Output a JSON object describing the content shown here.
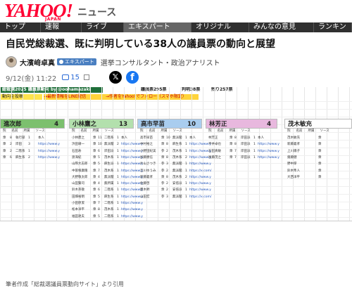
{
  "header": {
    "logo_main": "YAHOO!",
    "logo_sub": "JAPAN",
    "logo_section": "ニュース",
    "nav": [
      "トップ",
      "速報",
      "ライブ",
      "エキスパート",
      "オリジナル",
      "みんなの意見",
      "ランキン"
    ]
  },
  "article": {
    "title": "自民党総裁選、既に判明している38人の議員票の動向と展望",
    "author_name": "大濱﨑卓真",
    "author_badge": "エキスパート",
    "author_title": "選挙コンサルタント・政治アナリスト",
    "date": "9/12(金) 11:22",
    "comment_count": "15",
    "caption": "筆者作成「総裁選議員票動向サイト」より引用"
  },
  "sheet": {
    "site_title": "総裁選2025 議員票動向 by @oohamazaki",
    "row2_left": "動向を投稿",
    "row2_mid": "→最新情報をLINE配信",
    "row2_right": "→作者をYahoo!でフォロー（スマホ限定）",
    "stats_a": "議員票295票",
    "stats_b": "判明38票",
    "stats_c": "残り257票",
    "candidates": [
      {
        "name": "進次郎",
        "count": "4",
        "color": "#7cc06e"
      },
      {
        "name": "小林鷹之",
        "count": "13",
        "color": "#b3e0ad"
      },
      {
        "name": "高市早苗",
        "count": "10",
        "color": "#a9cdef"
      },
      {
        "name": "林芳正",
        "count": "4",
        "color": "#e8b8de"
      },
      {
        "name": "茂木敏充",
        "count": "",
        "color": "#ffffff"
      }
    ],
    "col_headers": [
      "院",
      "名前",
      "所属",
      "ソース"
    ],
    "entries_c0": [
      [
        "衆",
        "8",
        "執行部",
        "1",
        "本人"
      ],
      [
        "衆",
        "2",
        "岸田",
        "3",
        "https://www.y"
      ],
      [
        "衆",
        "2",
        "二階系",
        "1",
        "https://www.y"
      ],
      [
        "衆",
        "6",
        "麻生系",
        "2",
        "https://www.y"
      ]
    ],
    "entries_c1": [
      [
        "小林鷹之",
        "衆",
        "11",
        "二階系",
        "1",
        "本人"
      ],
      [
        "浜田靖一",
        "衆",
        "10",
        "無派閥",
        "2",
        "https://www.y"
      ],
      [
        "石田寿",
        "衆",
        "6",
        "岸田派",
        "1",
        "https://www.y"
      ],
      [
        "渡海紀",
        "衆",
        "5",
        "茂木系",
        "1",
        "https://www.y"
      ],
      [
        "山際大志郎",
        "衆",
        "5",
        "麻生派",
        "1",
        "https://www.y"
      ],
      [
        "中曽根康隆",
        "衆",
        "7",
        "茂木系",
        "1",
        "https://www.y"
      ],
      [
        "大野敬太郎",
        "衆",
        "4",
        "無派閥",
        "1",
        "https://www.y"
      ],
      [
        "山田賢司",
        "衆",
        "4",
        "無所属",
        "1",
        "https://www.y"
      ],
      [
        "鈴木英敬",
        "衆",
        "6",
        "二階系",
        "1",
        "https://www.y"
      ],
      [
        "田畑裕明",
        "衆",
        "5",
        "麻生系",
        "1",
        "https://www.y"
      ],
      [
        "小田原潔",
        "衆",
        "7",
        "二階系",
        "1",
        "https://www.y"
      ],
      [
        "松本洋平",
        "衆",
        "8",
        "茂木系",
        "1",
        "https://www.y"
      ],
      [
        "福田達夫",
        "衆",
        "5",
        "二階系",
        "1",
        "https://www.y"
      ]
    ],
    "entries_c2": [
      [
        "高市早苗",
        "衆",
        "10",
        "無派閥",
        "1",
        "本人"
      ],
      [
        "中村裕之",
        "衆",
        "8",
        "麻生系",
        "1",
        "https://www.y"
      ],
      [
        "小野田紀美",
        "参",
        "2",
        "茂木系",
        "1",
        "https://www.y"
      ],
      [
        "加藤勝信",
        "衆",
        "8",
        "茂木系",
        "2",
        "https://www.y"
      ],
      [
        "片山さつき",
        "参",
        "3",
        "無派閥",
        "1",
        "https://www.y"
      ],
      [
        "吉川ゆうみ",
        "参",
        "2",
        "無派閥",
        "1",
        "https://x.com/"
      ],
      [
        "新藤義孝",
        "衆",
        "8",
        "茂木系",
        "2",
        "https://www.y"
      ],
      [
        "佐藤啓",
        "参",
        "2",
        "安倍派",
        "1",
        "https://www.y"
      ],
      [
        "鷹木幹",
        "衆",
        "2",
        "安倍派",
        "1",
        "https://www.y"
      ],
      [
        "山田宏",
        "参",
        "3",
        "無派閥",
        "1",
        "https://x.com/"
      ]
    ],
    "entries_c3": [
      [
        "林芳正",
        "衆",
        "8",
        "岸田派",
        "1",
        "本人"
      ],
      [
        "平井卓也",
        "衆",
        "8",
        "岸田派",
        "1",
        "https://www.y"
      ],
      [
        "石田真敏",
        "衆",
        "7",
        "岸田派",
        "1",
        "https://www.y"
      ],
      [
        "後藤茂之",
        "衆",
        "7",
        "岸田派",
        "1",
        "https://www.y"
      ]
    ],
    "entries_c4": [
      [
        "茂木敏充",
        "衆"
      ],
      [
        "新藤義孝",
        "衆"
      ],
      [
        "上川陽子",
        "衆"
      ],
      [
        "齋藤健",
        "衆"
      ],
      [
        "野中厚",
        "衆"
      ],
      [
        "鈴木隼人",
        "衆"
      ],
      [
        "大西洋平",
        "衆"
      ]
    ]
  }
}
